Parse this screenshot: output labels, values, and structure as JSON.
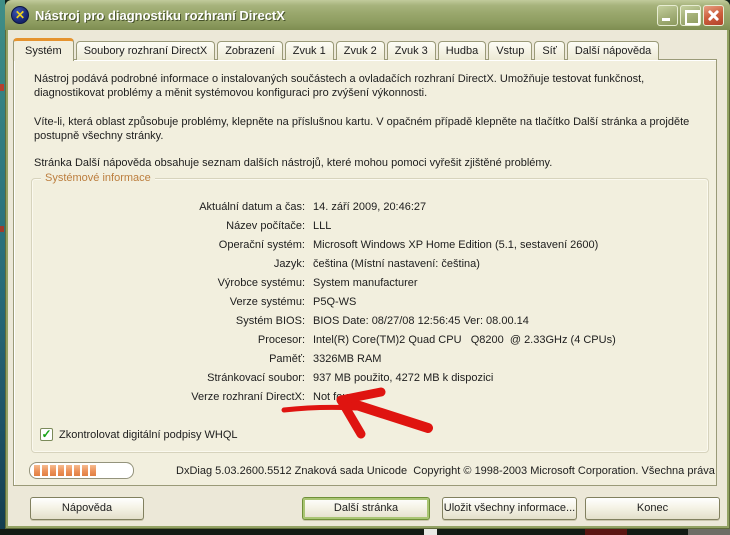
{
  "window": {
    "title": "Nástroj pro diagnostiku rozhraní DirectX",
    "icon": "directx-icon",
    "controls": [
      "minimize",
      "maximize",
      "close"
    ]
  },
  "tabs": [
    {
      "id": "system",
      "label": "Systém",
      "active": true
    },
    {
      "id": "files",
      "label": "Soubory rozhraní DirectX",
      "active": false
    },
    {
      "id": "display",
      "label": "Zobrazení",
      "active": false
    },
    {
      "id": "sound1",
      "label": "Zvuk 1",
      "active": false
    },
    {
      "id": "sound2",
      "label": "Zvuk 2",
      "active": false
    },
    {
      "id": "sound3",
      "label": "Zvuk 3",
      "active": false
    },
    {
      "id": "music",
      "label": "Hudba",
      "active": false
    },
    {
      "id": "input",
      "label": "Vstup",
      "active": false
    },
    {
      "id": "network",
      "label": "Síť",
      "active": false
    },
    {
      "id": "morehelp",
      "label": "Další nápověda",
      "active": false
    }
  ],
  "intro_paragraphs": {
    "p1": "Nástroj podává podrobné informace o instalovaných součástech a ovladačích rozhraní DirectX. Umožňuje testovat funkčnost, diagnostikovat problémy a měnit systémovou konfiguraci pro zvýšení výkonnosti.",
    "p2": "Víte-li, která oblast způsobuje problémy, klepněte na příslušnou kartu. V opačném případě klepněte na tlačítko Další stránka a projděte postupně všechny stránky.",
    "p3": "Stránka Další nápověda obsahuje seznam dalších nástrojů, které mohou pomoci vyřešit zjištěné problémy."
  },
  "system_info": {
    "group_label": "Systémové informace",
    "rows": [
      {
        "label": "Aktuální datum a čas:",
        "value": "14. září 2009, 20:46:27"
      },
      {
        "label": "Název počítače:",
        "value": "LLL"
      },
      {
        "label": "Operační systém:",
        "value": "Microsoft Windows XP Home Edition (5.1, sestavení 2600)"
      },
      {
        "label": "Jazyk:",
        "value": "čeština (Místní nastavení: čeština)"
      },
      {
        "label": "Výrobce systému:",
        "value": "System manufacturer"
      },
      {
        "label": "Verze systému:",
        "value": "P5Q-WS"
      },
      {
        "label": "Systém BIOS:",
        "value": "BIOS Date: 08/27/08 12:56:45 Ver: 08.00.14"
      },
      {
        "label": "Procesor:",
        "value": "Intel(R) Core(TM)2 Quad CPU   Q8200  @ 2.33GHz (4 CPUs)"
      },
      {
        "label": "Paměť:",
        "value": "3326MB RAM"
      },
      {
        "label": "Stránkovací soubor:",
        "value": "937 MB použito, 4272 MB k dispozici"
      },
      {
        "label": "Verze rozhraní DirectX:",
        "value": "Not found"
      }
    ],
    "checkbox": {
      "label": "Zkontrolovat digitální podpisy WHQL",
      "checked": true,
      "glyph": "✓"
    }
  },
  "statusbar": {
    "progress_segments_filled": 8,
    "progress_percent_approx": 60,
    "version_text": "DxDiag 5.03.2600.5512 Znaková sada Unicode  Copyright © 1998-2003 Microsoft Corporation. Všechna práva"
  },
  "buttons": {
    "help": "Nápověda",
    "next": "Další stránka",
    "save": "Uložit všechny informace...",
    "exit": "Konec"
  },
  "annotation": {
    "type": "red-arrow",
    "points_to": "Not found",
    "color": "#df1410"
  },
  "title_icon_glyph": "✕",
  "colors": {
    "titlebar_olive": "#99a76c",
    "client_beige": "#ece8d8",
    "tab_page": "#f2efde",
    "active_tab_accent": "#e5932f",
    "group_label": "#bc7e3e",
    "progress_segment": "#ec9159",
    "close_button": "#cd5f3d",
    "check_green": "#17a317"
  }
}
